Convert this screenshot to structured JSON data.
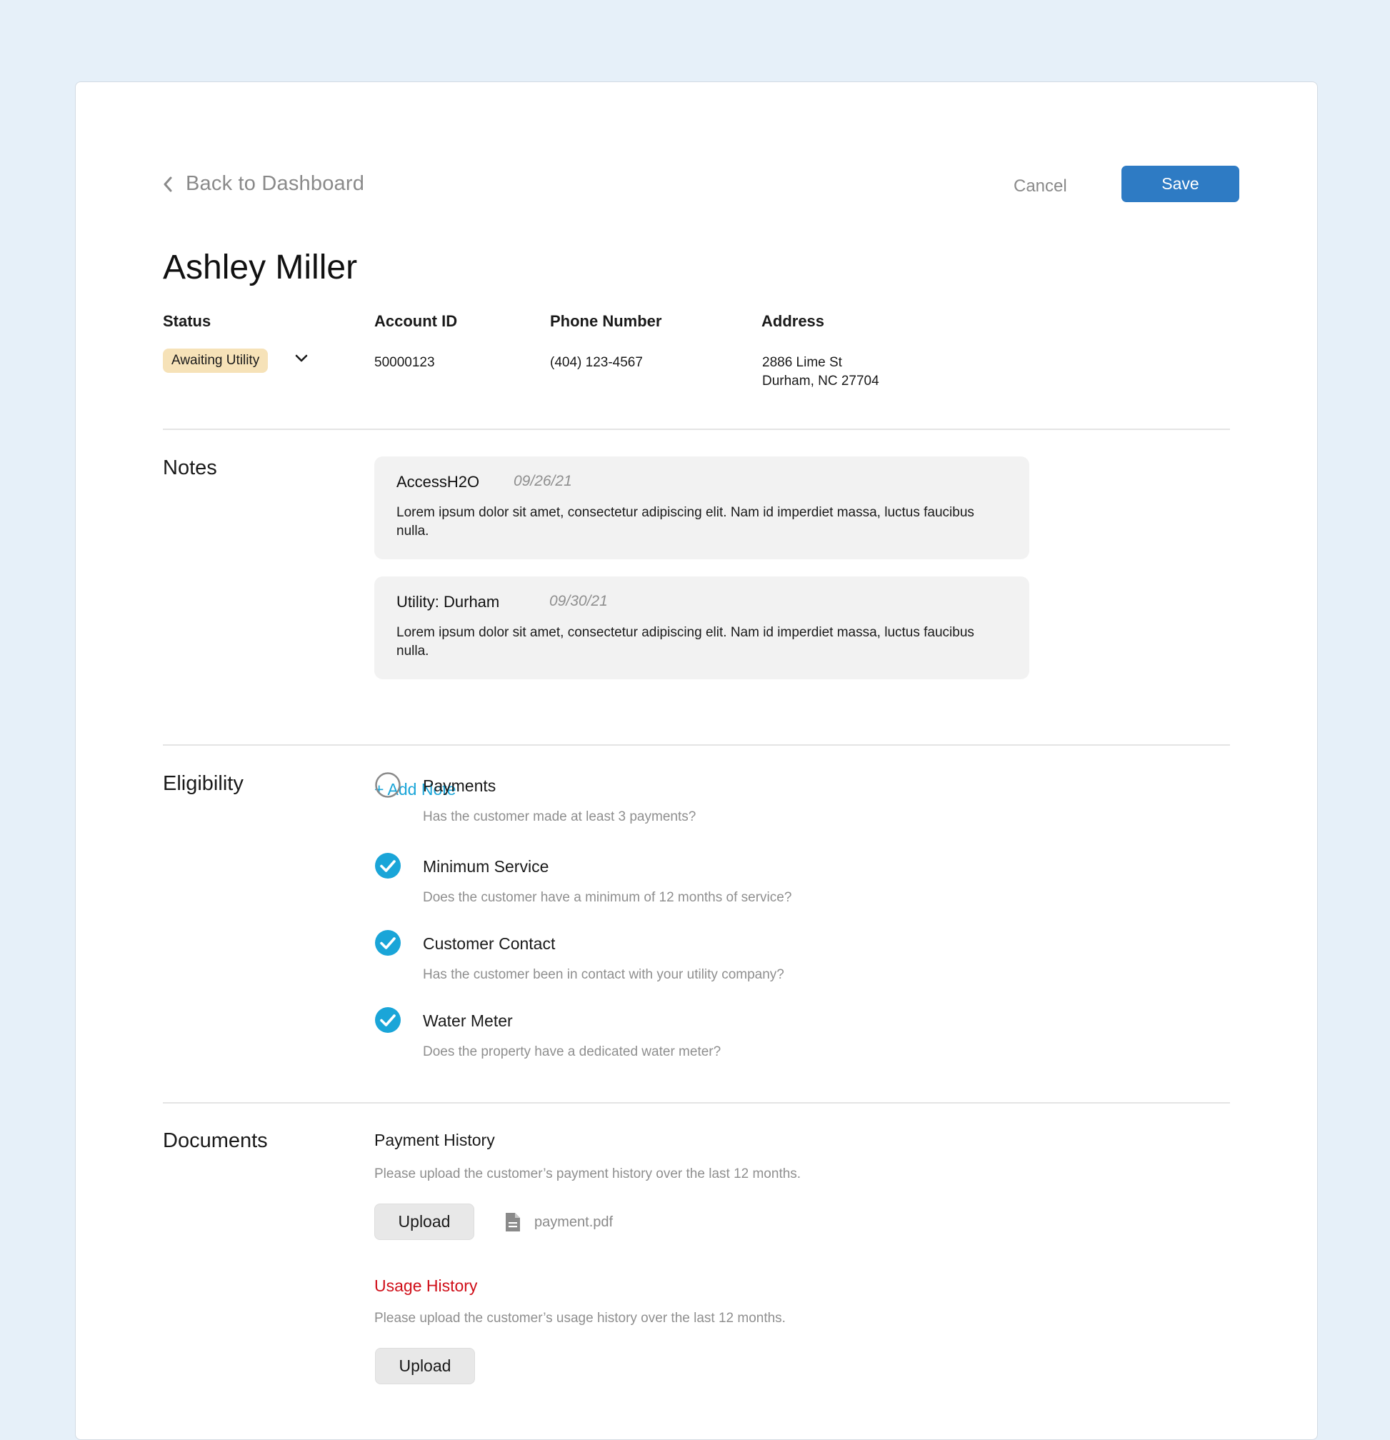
{
  "header": {
    "back_label": "Back to Dashboard",
    "cancel_label": "Cancel",
    "save_label": "Save"
  },
  "customer": {
    "name": "Ashley Miller",
    "status_label": "Status",
    "status_value": "Awaiting Utility",
    "account_label": "Account ID",
    "account_value": "50000123",
    "phone_label": "Phone Number",
    "phone_value": "(404) 123-4567",
    "address_label": "Address",
    "address_line1": "2886 Lime St",
    "address_line2": "Durham, NC 27704"
  },
  "notes": {
    "title": "Notes",
    "items": [
      {
        "author": "AccessH2O",
        "date": "09/26/21",
        "body": "Lorem ipsum dolor sit amet, consectetur adipiscing elit. Nam id imperdiet massa, luctus faucibus nulla."
      },
      {
        "author": "Utility: Durham",
        "date": "09/30/21",
        "body": "Lorem ipsum dolor sit amet, consectetur adipiscing elit. Nam id imperdiet massa, luctus faucibus nulla."
      }
    ],
    "add_label": "+ Add Note"
  },
  "eligibility": {
    "title": "Eligibility",
    "items": [
      {
        "title": "Payments",
        "question": "Has the customer made at least 3 payments?",
        "checked": false
      },
      {
        "title": "Minimum Service",
        "question": "Does the customer have a minimum of 12 months of service?",
        "checked": true
      },
      {
        "title": "Customer Contact",
        "question": "Has the customer been in contact with your utility company?",
        "checked": true
      },
      {
        "title": "Water Meter",
        "question": "Does the property have a dedicated water meter?",
        "checked": true
      }
    ]
  },
  "documents": {
    "title": "Documents",
    "items": [
      {
        "title": "Payment History",
        "description": "Please upload the customer’s payment history over the last 12 months.",
        "upload_label": "Upload",
        "file_name": "payment.pdf",
        "file_icon": "document-icon",
        "required_missing": false
      },
      {
        "title": "Usage History",
        "description": "Please upload the customer’s usage history over the last 12 months.",
        "upload_label": "Upload",
        "required_missing": true
      }
    ]
  },
  "colors": {
    "page_bg": "#e6f0f9",
    "primary": "#2e7bc4",
    "check": "#1aa5d8",
    "status_badge": "#f6e2b8",
    "error": "#d0101a"
  }
}
